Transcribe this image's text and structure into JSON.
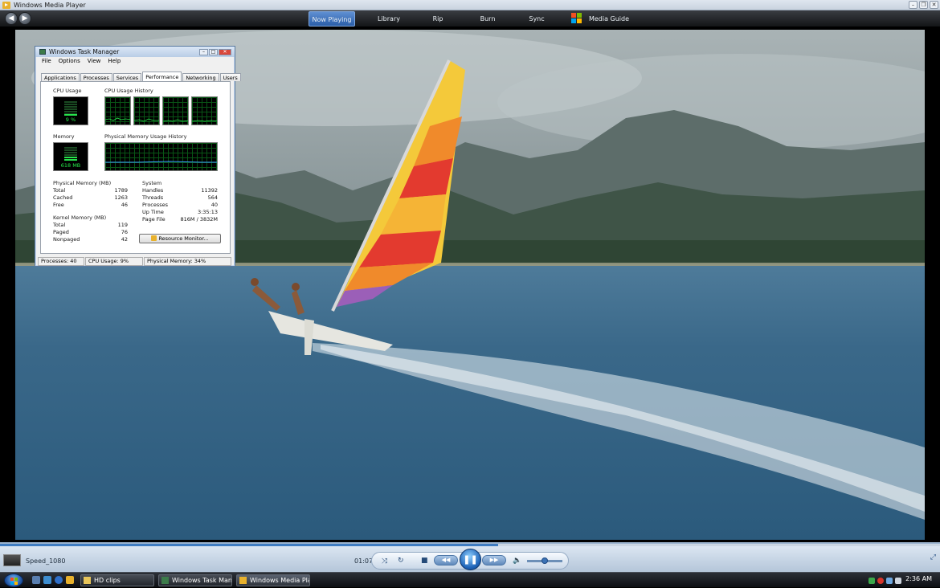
{
  "wmp": {
    "title": "Windows Media Player",
    "nav_tabs": [
      "Now Playing",
      "Library",
      "Rip",
      "Burn",
      "Sync",
      "Media Guide"
    ],
    "active_tab": "Now Playing",
    "clip_name": "Speed_1080",
    "elapsed": "01:07",
    "progress": 0.53,
    "volume": 0.5
  },
  "task_manager": {
    "title": "Windows Task Manager",
    "menu": [
      "File",
      "Options",
      "View",
      "Help"
    ],
    "tabs": [
      "Applications",
      "Processes",
      "Services",
      "Performance",
      "Networking",
      "Users"
    ],
    "active_tab": "Performance",
    "cpu_usage_label": "CPU Usage",
    "cpu_usage_value": "9 %",
    "cpu_history_label": "CPU Usage History",
    "memory_label": "Memory",
    "memory_value": "618 MB",
    "mem_history_label": "Physical Memory Usage History",
    "physical_memory": {
      "header": "Physical Memory (MB)",
      "rows": [
        [
          "Total",
          "1789"
        ],
        [
          "Cached",
          "1263"
        ],
        [
          "Free",
          "46"
        ]
      ]
    },
    "kernel_memory": {
      "header": "Kernel Memory (MB)",
      "rows": [
        [
          "Total",
          "119"
        ],
        [
          "Paged",
          "76"
        ],
        [
          "Nonpaged",
          "42"
        ]
      ]
    },
    "system": {
      "header": "System",
      "rows": [
        [
          "Handles",
          "11392"
        ],
        [
          "Threads",
          "564"
        ],
        [
          "Processes",
          "40"
        ],
        [
          "Up Time",
          "3:35:13"
        ],
        [
          "Page File",
          "816M / 3832M"
        ]
      ]
    },
    "resource_monitor_button": "Resource Monitor...",
    "status": [
      "Processes: 40",
      "CPU Usage: 9%",
      "Physical Memory: 34%"
    ],
    "cpu_percent": 0.09,
    "mem_percent": 0.34
  },
  "taskbar": {
    "buttons": [
      "HD clips",
      "Windows Task Man...",
      "Windows Media Pla..."
    ],
    "active": "Windows Media Pla...",
    "clock": "2:36 AM"
  },
  "colors": {
    "graph_green": "#27e34c",
    "wmp_accent": "#2a5ea8",
    "sail_stripes": [
      "#f4c93a",
      "#f08a2b",
      "#e33a2f",
      "#f5b436",
      "#9b5fb8"
    ]
  }
}
